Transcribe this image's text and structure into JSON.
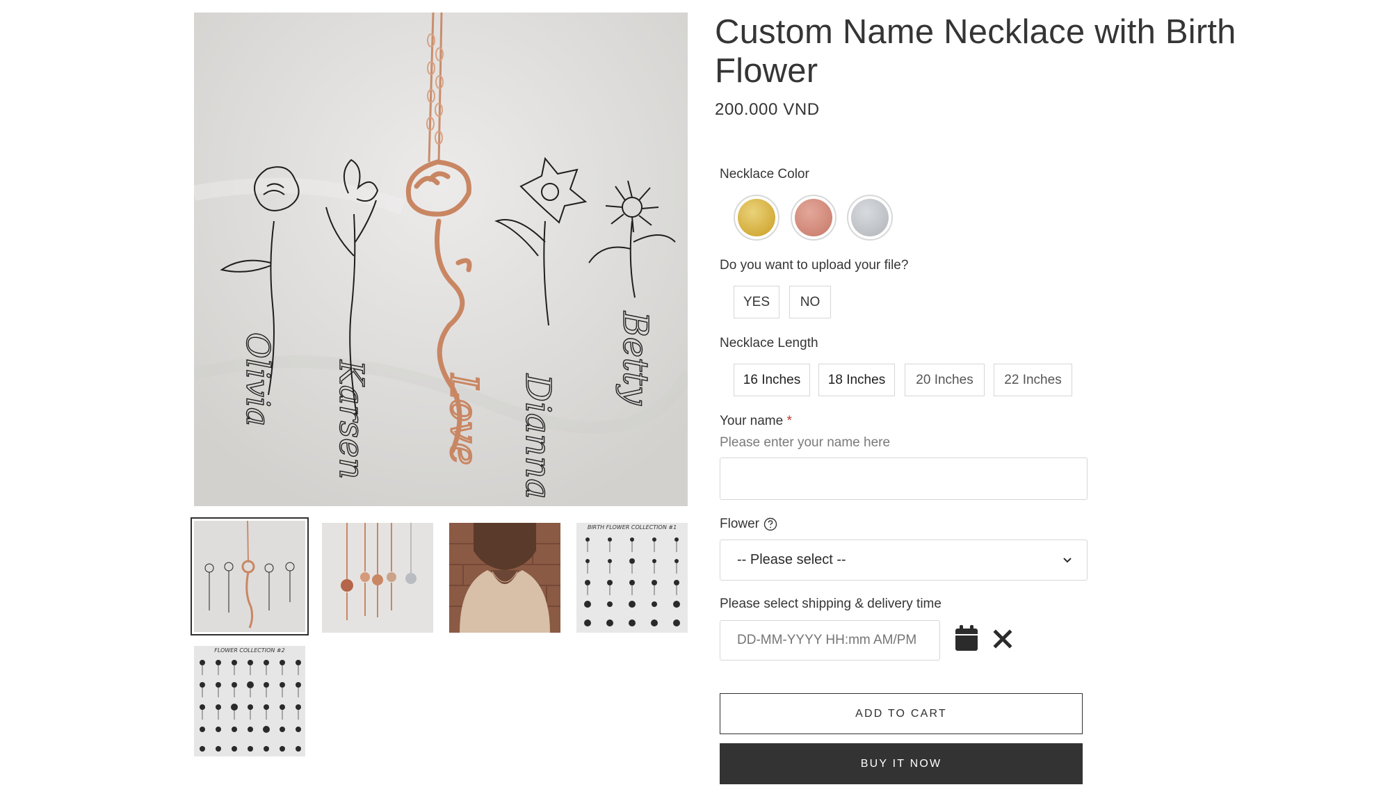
{
  "product": {
    "title": "Custom Name Necklace with Birth Flower",
    "price": "200.000 VND"
  },
  "gallery": {
    "main_image": "birth-flower-name-necklaces-photo",
    "thumbnails": [
      {
        "name": "necklaces-on-fabric",
        "active": true
      },
      {
        "name": "flower-pendants-closeup",
        "active": false
      },
      {
        "name": "model-wearing-necklace",
        "active": false
      },
      {
        "name": "birth-flower-collection-1",
        "caption": "BIRTH FLOWER COLLECTION #1",
        "active": false
      },
      {
        "name": "birth-flower-collection-2",
        "caption": "FLOWER COLLECTION #2",
        "active": false
      }
    ],
    "main_names": [
      "Olivia",
      "Karsen",
      "Love",
      "Dianna",
      "Betty"
    ]
  },
  "options": {
    "color": {
      "label": "Necklace Color",
      "swatches": [
        {
          "name": "gold",
          "color": "#d9b64a"
        },
        {
          "name": "rose-gold",
          "color": "#d38c7e"
        },
        {
          "name": "silver",
          "color": "#bfc3c7"
        }
      ]
    },
    "upload": {
      "label": "Do you want to upload your file?",
      "choices": [
        "YES",
        "NO"
      ]
    },
    "length": {
      "label": "Necklace Length",
      "choices": [
        "16 Inches",
        "18 Inches",
        "20 Inches",
        "22 Inches"
      ]
    },
    "name": {
      "label": "Your name",
      "required_mark": "*",
      "hint": "Please enter your name here",
      "value": ""
    },
    "flower": {
      "label": "Flower",
      "selected": "-- Please select --",
      "help_icon": "question-circle-icon"
    },
    "shipping": {
      "label": "Please select shipping & delivery time",
      "placeholder": "DD-MM-YYYY HH:mm AM/PM",
      "calendar_icon": "calendar-icon",
      "clear_icon": "close-icon"
    }
  },
  "actions": {
    "add_to_cart": "ADD TO CART",
    "buy_now": "BUY IT NOW"
  },
  "colors": {
    "text": "#353535",
    "required": "#c0392b",
    "buy_button_bg": "#333333"
  }
}
